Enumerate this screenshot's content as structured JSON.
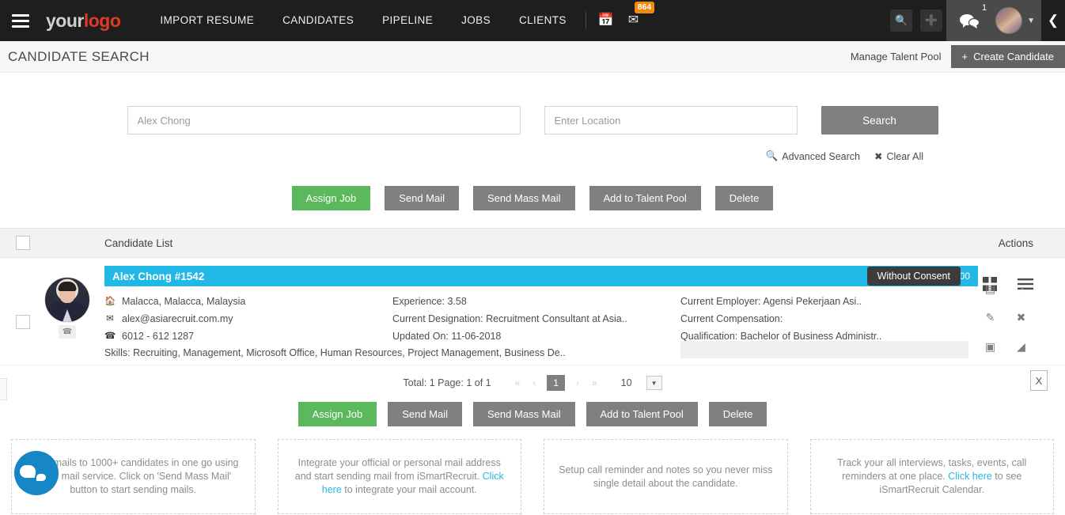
{
  "topnav": {
    "menu_icon": "hamburger-icon",
    "logo_part1": "your",
    "logo_part2": "logo",
    "links": [
      {
        "label": "IMPORT RESUME"
      },
      {
        "label": "CANDIDATES"
      },
      {
        "label": "PIPELINE"
      },
      {
        "label": "JOBS"
      },
      {
        "label": "CLIENTS"
      }
    ],
    "calendar_icon": "calendar-icon",
    "mail_icon": "envelope-icon",
    "mail_badge": "864",
    "search_icon": "search-icon",
    "add_icon": "plus-icon",
    "chat_icon": "chat-bubbles-icon",
    "chat_badge": "1",
    "avatar": "user-avatar",
    "caret": "chevron-down-icon",
    "collapse_icon": "chevron-left-icon"
  },
  "titlebar": {
    "title": "CANDIDATE SEARCH",
    "manage_talent_pool": "Manage Talent Pool",
    "create_candidate": "Create Candidate",
    "create_plus": "+"
  },
  "search": {
    "keyword_value": "Alex Chong",
    "keyword_placeholder": "Alex Chong",
    "location_value": "",
    "location_placeholder": "Enter Location",
    "search_button": "Search",
    "advanced_search": "Advanced Search",
    "clear_all": "Clear All"
  },
  "bulk_actions": [
    {
      "label": "Assign Job",
      "style": "green"
    },
    {
      "label": "Send Mail",
      "style": "grey"
    },
    {
      "label": "Send Mass Mail",
      "style": "grey"
    },
    {
      "label": "Add to Talent Pool",
      "style": "grey"
    },
    {
      "label": "Delete",
      "style": "grey"
    }
  ],
  "view_toggle": {
    "grid_icon": "grid-view-icon",
    "list_icon": "list-view-icon"
  },
  "list_header": {
    "title": "Candidate List",
    "actions": "Actions"
  },
  "candidate": {
    "name": "Alex Chong #1542",
    "linkedin_icon": "linkedin-icon",
    "consent_icon": "shield-warning-icon",
    "score": "00",
    "tooltip": "Without Consent",
    "location": "Malacca, Malacca, Malaysia",
    "email": "alex@asiarecruit.com.my",
    "phone": "6012 - 612 1287",
    "experience": "Experience: 3.58",
    "designation": "Current Designation: Recruitment Consultant at Asia..",
    "updated_on": "Updated On: 11-06-2018",
    "employer": "Current Employer: Agensi Pekerjaan Asi..",
    "compensation": "Current Compensation:",
    "qualification": "Qualification: Bachelor of Business Administr..",
    "skills": "Skills: Recruiting, Management, Microsoft Office, Human Resources, Project Management, Business De..",
    "row_icons": [
      {
        "name": "resume-doc-icon",
        "glyph": "▤"
      },
      {
        "name": "history-clock-icon",
        "glyph": "◔"
      },
      {
        "name": "edit-pencil-icon",
        "glyph": "✎"
      },
      {
        "name": "delete-x-icon",
        "glyph": "✖"
      },
      {
        "name": "save-disk-icon",
        "glyph": "▣"
      },
      {
        "name": "tag-icon",
        "glyph": "◢"
      }
    ]
  },
  "pagination": {
    "total_text": "Total: 1 Page: 1 of 1",
    "first": "«",
    "prev": "‹",
    "current_page": "1",
    "next": "›",
    "last": "»",
    "page_size": "10",
    "export_icon": "excel-export-icon",
    "export_glyph": "X"
  },
  "info_cards": [
    {
      "text_before": "Send mails to 1000+ candidates in one go using mass mail service. Click on 'Send Mass Mail' button to start sending mails.",
      "link": "",
      "text_after": ""
    },
    {
      "text_before": "Integrate your official or personal mail address and start sending mail from iSmartRecruit. ",
      "link": "Click here",
      "text_after": " to integrate your mail account."
    },
    {
      "text_before": "Setup call reminder and notes so you never miss single detail about the candidate.",
      "link": "",
      "text_after": ""
    },
    {
      "text_before": "Track your all interviews, tasks, events, call reminders at one place. ",
      "link": "Click here",
      "text_after": " to see iSmartRecruit Calendar."
    }
  ],
  "chat_widget": {
    "name": "live-chat-button"
  },
  "colors": {
    "accent_blue": "#22b8e5",
    "green": "#5cb85c",
    "grey_button": "#808080",
    "nav_dark": "#1e1e1e",
    "badge_orange": "#f08b0b",
    "link_blue": "#29b6e0"
  }
}
